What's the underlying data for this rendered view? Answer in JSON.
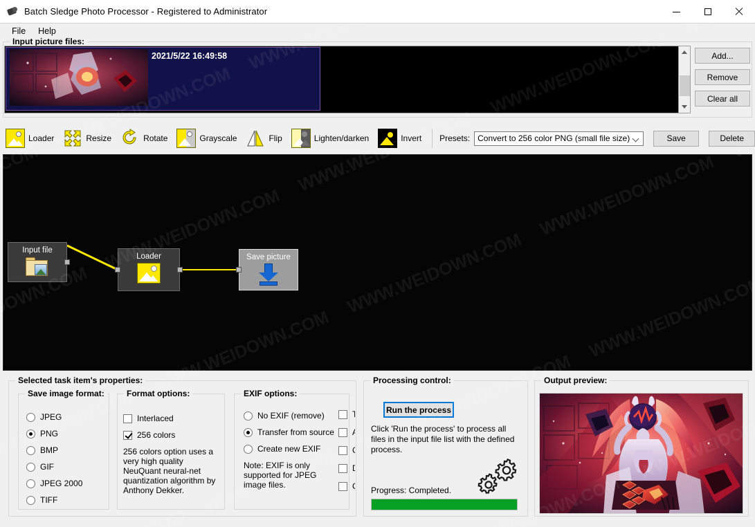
{
  "window": {
    "title": "Batch Sledge Photo Processor - Registered to Administrator",
    "icon": "app-icon",
    "controls": {
      "minimize": "–",
      "maximize": "□",
      "close": "✕"
    }
  },
  "menu": {
    "items": [
      {
        "label": "File"
      },
      {
        "label": "Help"
      }
    ]
  },
  "file_list": {
    "group_title": "Input picture files:",
    "items": [
      {
        "date": "2021/5/22 16:49:58",
        "selected": true
      }
    ],
    "buttons": [
      {
        "label": "Add...",
        "name": "add-button"
      },
      {
        "label": "Remove",
        "name": "remove-button"
      },
      {
        "label": "Clear all",
        "name": "clear-all-button"
      }
    ]
  },
  "toolbar": {
    "tools": [
      {
        "label": "Loader",
        "icon": "picture-icon"
      },
      {
        "label": "Resize",
        "icon": "resize-arrows-icon"
      },
      {
        "label": "Rotate",
        "icon": "rotate-icon"
      },
      {
        "label": "Grayscale",
        "icon": "grayscale-icon"
      },
      {
        "label": "Flip",
        "icon": "flip-icon"
      },
      {
        "label": "Lighten/darken",
        "icon": "lighten-darken-icon"
      },
      {
        "label": "Invert",
        "icon": "invert-icon"
      }
    ],
    "presets_label": "Presets:",
    "presets_value": "Convert to 256 color PNG (small file size)",
    "save_label": "Save",
    "delete_label": "Delete"
  },
  "graph": {
    "nodes": [
      {
        "title": "Input file",
        "icon": "folder-picture-icon",
        "selected": false
      },
      {
        "title": "Loader",
        "icon": "picture-icon",
        "selected": false
      },
      {
        "title": "Save picture",
        "icon": "save-arrow-icon",
        "selected": true
      }
    ]
  },
  "properties": {
    "group_title": "Selected task item's properties:",
    "save_format": {
      "group_title": "Save image format:",
      "options": [
        {
          "label": "JPEG",
          "selected": false
        },
        {
          "label": "PNG",
          "selected": true
        },
        {
          "label": "BMP",
          "selected": false
        },
        {
          "label": "GIF",
          "selected": false
        },
        {
          "label": "JPEG 2000",
          "selected": false
        },
        {
          "label": "TIFF",
          "selected": false
        }
      ]
    },
    "format_options": {
      "group_title": "Format options:",
      "checkboxes": [
        {
          "label": "Interlaced",
          "checked": false
        },
        {
          "label": "256 colors",
          "checked": true
        }
      ],
      "note": "256 colors option uses a very high quality NeuQuant neural-net quantization algorithm by Anthony Dekker."
    },
    "exif_options": {
      "group_title": "EXIF options:",
      "radios": [
        {
          "label": "No EXIF (remove)",
          "selected": false
        },
        {
          "label": "Transfer from source",
          "selected": true
        },
        {
          "label": "Create new EXIF",
          "selected": false
        }
      ],
      "note": "Note: EXIF is only supported for JPEG image files.",
      "clipped_checkboxes": [
        {
          "label": "Ti",
          "checked": false
        },
        {
          "label": "Ar",
          "checked": false
        },
        {
          "label": "Co",
          "checked": false
        },
        {
          "label": "De",
          "checked": false
        },
        {
          "label": "Co",
          "checked": false
        }
      ]
    }
  },
  "processing": {
    "group_title": "Processing control:",
    "run_button": "Run the process",
    "help_text": "Click 'Run the process' to process all files in the input file list with the defined process.",
    "progress_label": "Progress:  Completed.",
    "progress_percent": 100,
    "progress_color": "#06a024",
    "gears_icon": "gears-icon"
  },
  "output_preview": {
    "group_title": "Output preview:",
    "image": "processed-artwork-preview"
  },
  "watermark": {
    "text": "WWW.WEIDOWN.COM"
  }
}
